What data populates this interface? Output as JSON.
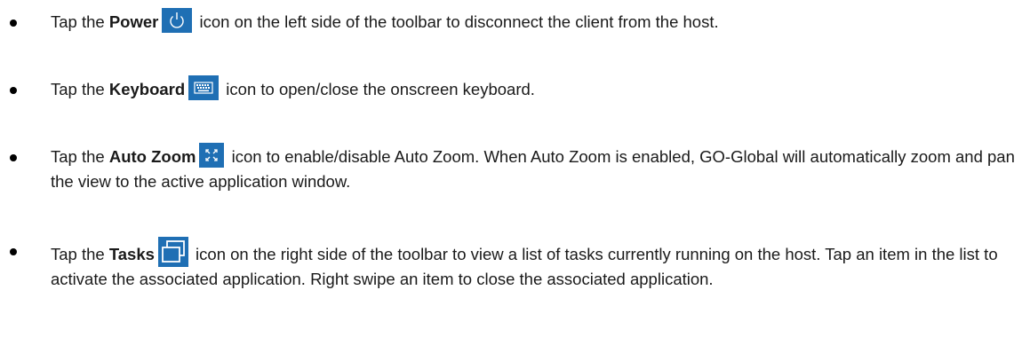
{
  "items": [
    {
      "pre": "Tap the ",
      "bold": "Power",
      "icon": "power-icon",
      "post": " icon on the left side of the toolbar to disconnect the client from the host."
    },
    {
      "pre": "Tap the ",
      "bold": "Keyboard",
      "icon": "keyboard-icon",
      "post": " icon to open/close the onscreen keyboard."
    },
    {
      "pre": "Tap the ",
      "bold": "Auto Zoom",
      "icon": "expand-arrows-icon",
      "post": " icon to enable/disable Auto Zoom. When Auto Zoom is enabled, GO-Global will automatically zoom and pan the view to the active application window."
    },
    {
      "pre": "Tap the ",
      "bold": "Tasks",
      "icon": "overlapping-windows-icon",
      "post": " icon on the right side of the toolbar to view a list of tasks currently running on the host. Tap an item in the list to activate the associated application. Right swipe an item to close the associated application."
    }
  ],
  "colors": {
    "icon_background": "#1f6fb4",
    "icon_foreground": "#ffffff",
    "text": "#1a1a1a"
  }
}
